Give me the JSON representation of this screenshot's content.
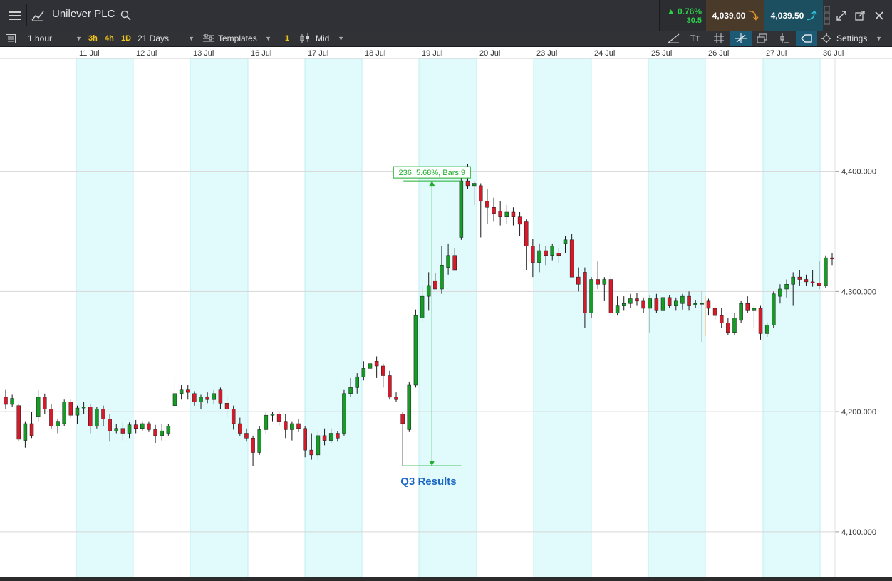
{
  "topbar": {
    "title": "Unilever PLC",
    "change_pct": "0.76%",
    "change_abs": "30.5",
    "sell_price": "4,039.00",
    "buy_price": "4,039.50"
  },
  "toolbar": {
    "interval": "1 hour",
    "quick_intervals": [
      "3h",
      "4h",
      "1D"
    ],
    "range": "21 Days",
    "templates_label": "Templates",
    "badge": "1",
    "price_type": "Mid",
    "settings_label": "Settings"
  },
  "chart_data": {
    "type": "candlestick",
    "x_labels": [
      "11 Jul",
      "12 Jul",
      "13 Jul",
      "16 Jul",
      "17 Jul",
      "18 Jul",
      "19 Jul",
      "20 Jul",
      "23 Jul",
      "24 Jul",
      "25 Jul",
      "26 Jul",
      "27 Jul",
      "30 Jul"
    ],
    "y_ticks": [
      "4,400.000",
      "4,300.000",
      "4,200.000",
      "4,100.000"
    ],
    "ylim": [
      4062,
      4494
    ],
    "measure_label": "236, 5.68%, Bars:9",
    "annotation": "Q3 Results",
    "candles": [
      [
        4212,
        4218,
        4202,
        4206
      ],
      [
        4206,
        4214,
        4204,
        4211
      ],
      [
        4205,
        4206,
        4175,
        4177
      ],
      [
        4176,
        4192,
        4170,
        4190
      ],
      [
        4190,
        4200,
        4178,
        4180
      ],
      [
        4196,
        4218,
        4192,
        4212
      ],
      [
        4212,
        4215,
        4198,
        4202
      ],
      [
        4202,
        4206,
        4186,
        4188
      ],
      [
        4188,
        4194,
        4182,
        4192
      ],
      [
        4190,
        4210,
        4188,
        4208
      ],
      [
        4208,
        4210,
        4195,
        4197
      ],
      [
        4197,
        4205,
        4190,
        4203
      ],
      [
        4203,
        4208,
        4198,
        4204
      ],
      [
        4204,
        4206,
        4182,
        4188
      ],
      [
        4188,
        4204,
        4186,
        4202
      ],
      [
        4202,
        4205,
        4188,
        4194
      ],
      [
        4194,
        4198,
        4175,
        4184
      ],
      [
        4184,
        4190,
        4182,
        4186
      ],
      [
        4186,
        4191,
        4176,
        4182
      ],
      [
        4182,
        4191,
        4178,
        4189
      ],
      [
        4189,
        4193,
        4182,
        4186
      ],
      [
        4186,
        4192,
        4184,
        4190
      ],
      [
        4190,
        4192,
        4183,
        4185
      ],
      [
        4185,
        4189,
        4174,
        4180
      ],
      [
        4180,
        4190,
        4176,
        4184
      ],
      [
        4182,
        4190,
        4180,
        4188
      ],
      [
        4205,
        4228,
        4202,
        4215
      ],
      [
        4215,
        4222,
        4210,
        4218
      ],
      [
        4218,
        4222,
        4210,
        4216
      ],
      [
        4215,
        4217,
        4205,
        4208
      ],
      [
        4208,
        4214,
        4202,
        4212
      ],
      [
        4212,
        4216,
        4207,
        4210
      ],
      [
        4210,
        4218,
        4206,
        4215
      ],
      [
        4218,
        4220,
        4202,
        4207
      ],
      [
        4207,
        4212,
        4195,
        4202
      ],
      [
        4202,
        4205,
        4185,
        4190
      ],
      [
        4190,
        4195,
        4180,
        4182
      ],
      [
        4182,
        4186,
        4175,
        4178
      ],
      [
        4178,
        4180,
        4155,
        4166
      ],
      [
        4166,
        4188,
        4164,
        4185
      ],
      [
        4185,
        4200,
        4182,
        4197
      ],
      [
        4197,
        4200,
        4192,
        4198
      ],
      [
        4198,
        4200,
        4188,
        4192
      ],
      [
        4192,
        4198,
        4178,
        4185
      ],
      [
        4185,
        4192,
        4176,
        4190
      ],
      [
        4190,
        4194,
        4183,
        4186
      ],
      [
        4186,
        4188,
        4162,
        4168
      ],
      [
        4168,
        4182,
        4160,
        4164
      ],
      [
        4164,
        4184,
        4160,
        4180
      ],
      [
        4180,
        4186,
        4172,
        4176
      ],
      [
        4176,
        4186,
        4174,
        4182
      ],
      [
        4182,
        4184,
        4175,
        4178
      ],
      [
        4182,
        4218,
        4180,
        4215
      ],
      [
        4215,
        4228,
        4212,
        4220
      ],
      [
        4220,
        4232,
        4215,
        4229
      ],
      [
        4229,
        4242,
        4226,
        4236
      ],
      [
        4236,
        4245,
        4230,
        4240
      ],
      [
        4242,
        4246,
        4228,
        4238
      ],
      [
        4238,
        4240,
        4220,
        4230
      ],
      [
        4230,
        4234,
        4210,
        4212
      ],
      [
        4212,
        4216,
        4208,
        4210
      ],
      [
        4198,
        4200,
        4155,
        4190
      ],
      [
        4185,
        4225,
        4183,
        4222
      ],
      [
        4222,
        4285,
        4220,
        4280
      ],
      [
        4278,
        4304,
        4275,
        4296
      ],
      [
        4296,
        4316,
        4284,
        4305
      ],
      [
        4309,
        4315,
        4304,
        4302
      ],
      [
        4302,
        4338,
        4298,
        4322
      ],
      [
        4320,
        4340,
        4314,
        4330
      ],
      [
        4330,
        4336,
        4318,
        4318
      ],
      [
        4345,
        4399,
        4343,
        4392
      ],
      [
        4392,
        4406,
        4385,
        4388
      ],
      [
        4388,
        4392,
        4372,
        4390
      ],
      [
        4388,
        4390,
        4345,
        4375
      ],
      [
        4375,
        4385,
        4356,
        4370
      ],
      [
        4370,
        4378,
        4358,
        4365
      ],
      [
        4367,
        4375,
        4355,
        4362
      ],
      [
        4362,
        4372,
        4356,
        4366
      ],
      [
        4366,
        4370,
        4355,
        4362
      ],
      [
        4362,
        4366,
        4346,
        4356
      ],
      [
        4358,
        4360,
        4318,
        4338
      ],
      [
        4338,
        4344,
        4312,
        4324
      ],
      [
        4324,
        4340,
        4316,
        4334
      ],
      [
        4334,
        4338,
        4322,
        4330
      ],
      [
        4330,
        4340,
        4326,
        4338
      ],
      [
        4332,
        4336,
        4324,
        4330
      ],
      [
        4340,
        4346,
        4332,
        4343
      ],
      [
        4343,
        4348,
        4316,
        4312
      ],
      [
        4312,
        4320,
        4300,
        4306
      ],
      [
        4316,
        4320,
        4270,
        4282
      ],
      [
        4282,
        4312,
        4278,
        4310
      ],
      [
        4310,
        4325,
        4302,
        4306
      ],
      [
        4306,
        4312,
        4292,
        4310
      ],
      [
        4310,
        4312,
        4280,
        4282
      ],
      [
        4282,
        4296,
        4280,
        4288
      ],
      [
        4288,
        4296,
        4284,
        4290
      ],
      [
        4290,
        4298,
        4286,
        4294
      ],
      [
        4294,
        4299,
        4288,
        4292
      ],
      [
        4292,
        4295,
        4282,
        4286
      ],
      [
        4286,
        4297,
        4266,
        4294
      ],
      [
        4294,
        4298,
        4282,
        4284
      ],
      [
        4284,
        4296,
        4280,
        4295
      ],
      [
        4295,
        4297,
        4286,
        4288
      ],
      [
        4288,
        4295,
        4284,
        4292
      ],
      [
        4290,
        4298,
        4285,
        4296
      ],
      [
        4296,
        4300,
        4284,
        4288
      ],
      [
        4289,
        4293,
        4286,
        4290
      ],
      [
        4290,
        4300,
        4258,
        4290
      ],
      [
        4292,
        4294,
        4280,
        4286
      ],
      [
        4286,
        4288,
        4276,
        4280
      ],
      [
        4280,
        4286,
        4270,
        4274
      ],
      [
        4274,
        4278,
        4264,
        4266
      ],
      [
        4266,
        4282,
        4264,
        4278
      ],
      [
        4276,
        4292,
        4274,
        4290
      ],
      [
        4290,
        4296,
        4282,
        4284
      ],
      [
        4284,
        4288,
        4270,
        4286
      ],
      [
        4286,
        4288,
        4260,
        4265
      ],
      [
        4265,
        4274,
        4262,
        4272
      ],
      [
        4272,
        4300,
        4270,
        4298
      ],
      [
        4296,
        4306,
        4290,
        4302
      ],
      [
        4302,
        4310,
        4295,
        4306
      ],
      [
        4306,
        4316,
        4288,
        4312
      ],
      [
        4312,
        4318,
        4305,
        4310
      ],
      [
        4310,
        4314,
        4305,
        4308
      ],
      [
        4308,
        4318,
        4304,
        4307
      ],
      [
        4307,
        4325,
        4302,
        4305
      ],
      [
        4305,
        4330,
        4303,
        4328
      ],
      [
        4328,
        4332,
        4322,
        4327
      ]
    ]
  }
}
